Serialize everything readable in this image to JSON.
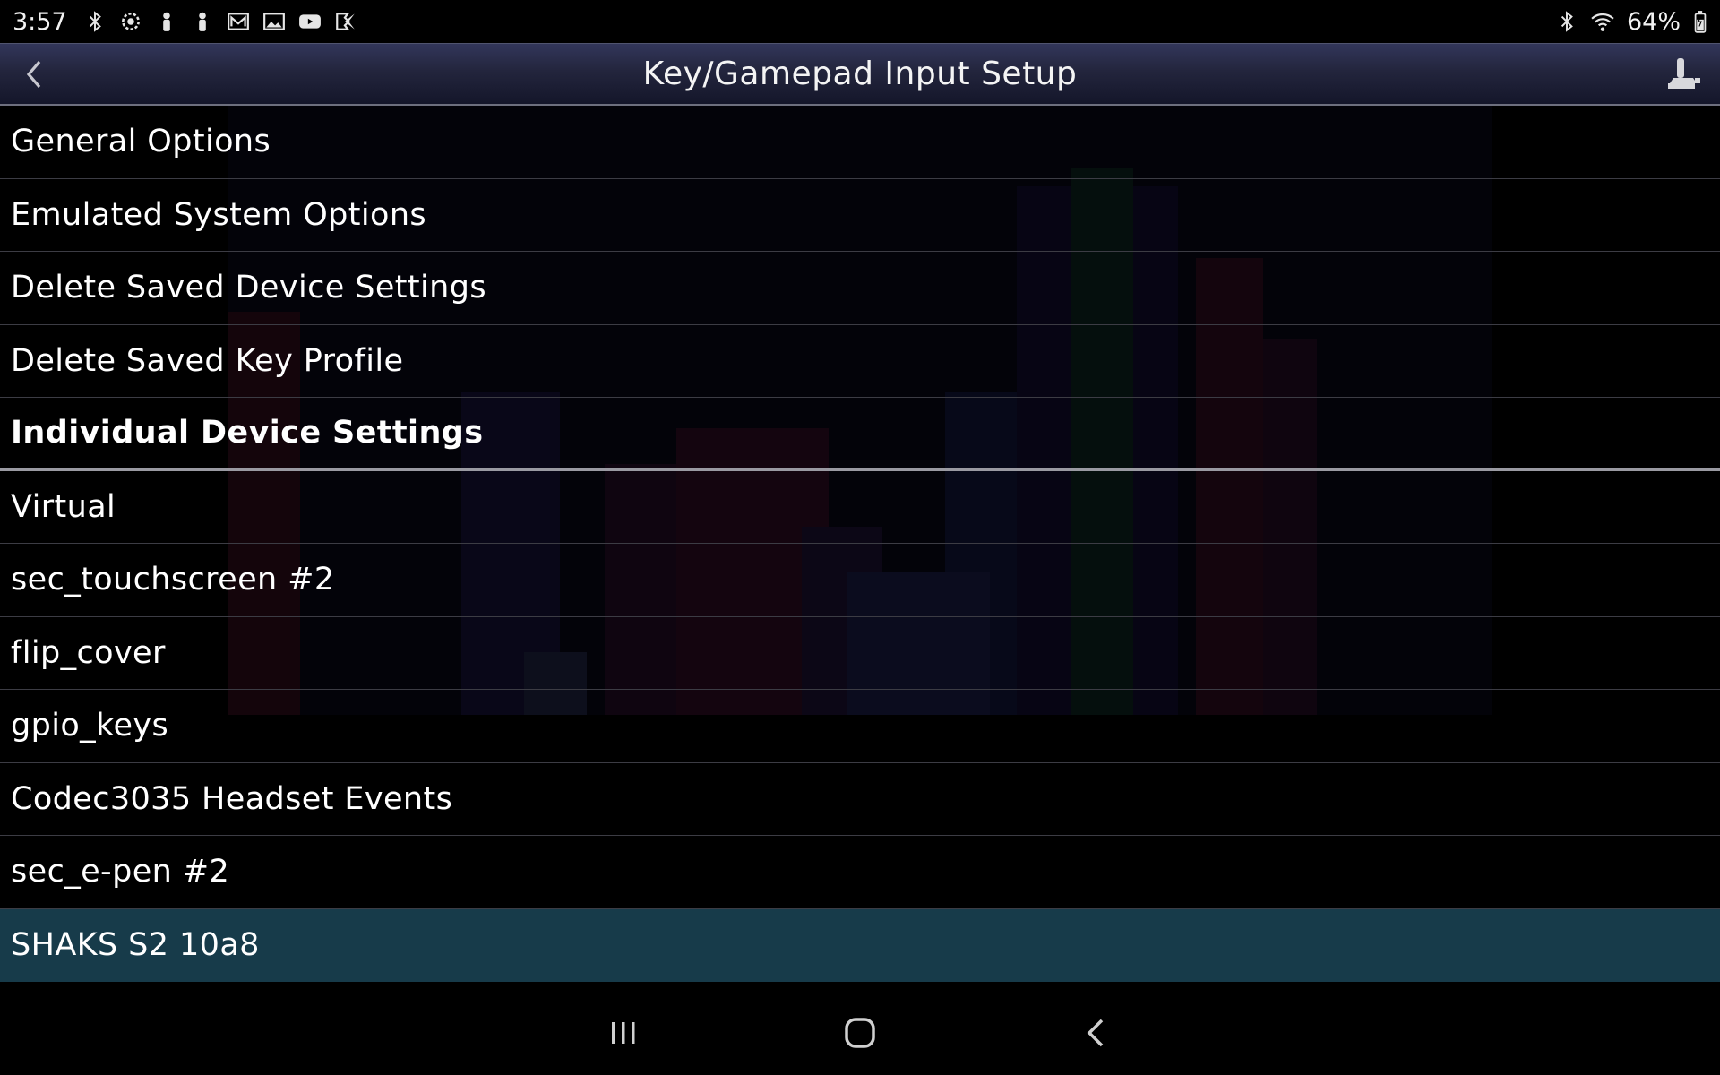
{
  "status_bar": {
    "time": "3:57",
    "battery_percent": "64%",
    "left_icons": [
      "bluetooth-icon",
      "settings-badge-icon",
      "person-icon",
      "person-icon",
      "mail-icon",
      "gallery-icon",
      "youtube-icon",
      "play-store-icon"
    ],
    "right_icons": [
      "bluetooth-icon",
      "wifi-icon",
      "battery-icon"
    ]
  },
  "app_bar": {
    "title": "Key/Gamepad Input Setup",
    "back_icon": "chevron-left-icon",
    "action_icon": "joystick-icon"
  },
  "menu": {
    "items": [
      {
        "label": "General Options"
      },
      {
        "label": "Emulated System Options"
      },
      {
        "label": "Delete Saved Device Settings"
      },
      {
        "label": "Delete Saved Key Profile"
      },
      {
        "label": "Individual Device Settings"
      },
      {
        "label": "Virtual"
      },
      {
        "label": "sec_touchscreen #2"
      },
      {
        "label": "flip_cover"
      },
      {
        "label": "gpio_keys"
      },
      {
        "label": "Codec3035 Headset Events"
      },
      {
        "label": "sec_e-pen #2"
      },
      {
        "label": "SHAKS S2 10a8"
      }
    ],
    "heading_index": 4,
    "selected_index": 11
  },
  "nav_bar": {
    "recents_icon": "recents-icon",
    "home_icon": "home-icon",
    "back_icon": "back-icon"
  },
  "colors": {
    "app_bar": "#23253d",
    "selected_row": "#173b4a",
    "divider": "#3c3c44",
    "heading_divider": "#9a9aa2"
  }
}
